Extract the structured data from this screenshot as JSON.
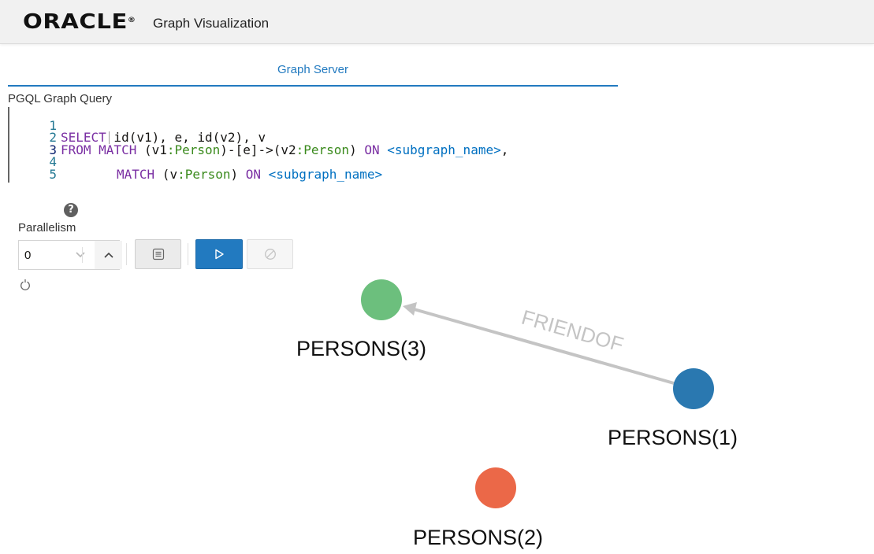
{
  "header": {
    "brand": "ORACLE",
    "brand_mark": "®",
    "title": "Graph Visualization"
  },
  "tabs": [
    {
      "label": "Graph Server",
      "active": true
    }
  ],
  "query": {
    "label": "PGQL Graph Query",
    "line_numbers": [
      "1",
      "2",
      "3",
      "4",
      "5"
    ],
    "line1": {
      "kw1": "SELECT",
      "t1": " id(v1), e, id(v2), v"
    },
    "line2": {
      "kw1": "FROM",
      "kw2": " MATCH",
      "t1": " (v1",
      "l1": ":Person",
      "t2": ")-[e]->(v2",
      "l2": ":Person",
      "t3": ") ",
      "kw3": "ON",
      "ph1": " <subgraph_name>",
      "t4": ","
    },
    "line3": {
      "kw1": "MATCH",
      "t1": " (v",
      "l1": ":Person",
      "t2": ") ",
      "kw2": "ON",
      "ph1": " <subgraph_name>"
    }
  },
  "help_icon": "question-mark-icon",
  "parallelism": {
    "label": "Parallelism",
    "value": "0"
  },
  "toolbar_icons": {
    "decrement": "chevron-down-icon",
    "increment": "chevron-up-icon",
    "list": "list-icon",
    "run": "play-icon",
    "cancel": "cancel-icon",
    "refresh": "refresh-icon"
  },
  "graph": {
    "nodes": [
      {
        "id": "PERSONS(3)",
        "label": "PERSONS(3)",
        "color": "#6cbf7d"
      },
      {
        "id": "PERSONS(1)",
        "label": "PERSONS(1)",
        "color": "#2a78b0"
      },
      {
        "id": "PERSONS(2)",
        "label": "PERSONS(2)",
        "color": "#eb6848"
      }
    ],
    "edges": [
      {
        "source": "PERSONS(1)",
        "target": "PERSONS(3)",
        "label": "FRIENDOF",
        "color": "#c4c4c4"
      }
    ]
  },
  "colors": {
    "accent": "#227ac0"
  }
}
